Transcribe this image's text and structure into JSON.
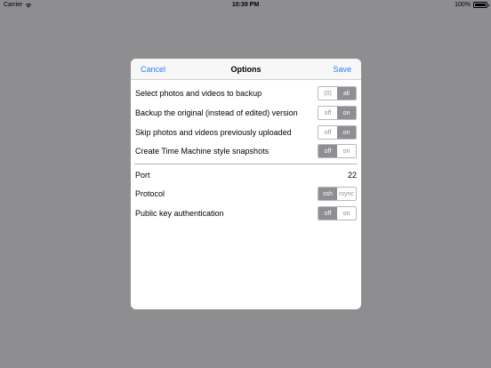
{
  "status_bar": {
    "carrier": "Carrier",
    "time": "10:39 PM",
    "battery": "100%"
  },
  "dialog": {
    "cancel_label": "Cancel",
    "title": "Options",
    "save_label": "Save",
    "rows": [
      {
        "label": "Select photos and videos to backup",
        "options": [
          "(0)",
          "all"
        ],
        "selected": 1
      },
      {
        "label": "Backup the original (instead of edited) version",
        "options": [
          "off",
          "on"
        ],
        "selected": 1
      },
      {
        "label": "Skip photos and videos previously uploaded",
        "options": [
          "off",
          "on"
        ],
        "selected": 1
      },
      {
        "label": "Create Time Machine style snapshots",
        "options": [
          "off",
          "on"
        ],
        "selected": 0
      }
    ],
    "port": {
      "label": "Port",
      "value": "22"
    },
    "protocol": {
      "label": "Protocol",
      "options": [
        "ssh",
        "rsync"
      ],
      "selected": 0
    },
    "pubkey": {
      "label": "Public key authentication",
      "options": [
        "off",
        "on"
      ],
      "selected": 0
    }
  },
  "colors": {
    "accent": "#2f7cf6",
    "background": "#8e8e91",
    "segment_selected": "#8e8e93"
  }
}
